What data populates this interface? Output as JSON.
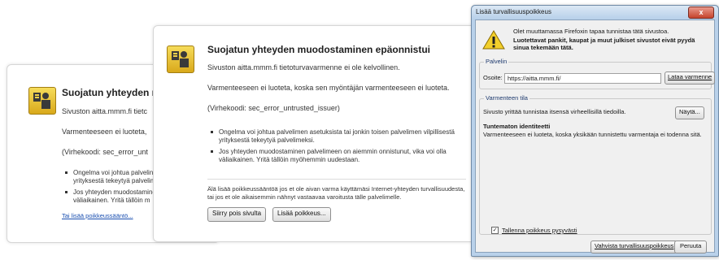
{
  "back": {
    "heading": "Suojatun yhteyden m",
    "line1": "Sivuston aitta.mmm.fi tietc",
    "line2": "Varmenteeseen ei luoteta,",
    "code": "(Virhekoodi: sec_error_unt",
    "bullets": [
      "Ongelma voi johtua palvelin",
      "yrityksestä tekeytyä palvelim",
      "Jos yhteyden muodostamine",
      "väliaikainen. Yritä tällöin m"
    ],
    "link": "Tai lisää poikkeussääntö..."
  },
  "mid": {
    "heading": "Suojatun yhteyden muodostaminen epäonnistui",
    "line1": "Sivuston aitta.mmm.fi tietoturvavarmenne ei ole kelvollinen.",
    "line2": "Varmenteeseen ei luoteta, koska sen myöntäjän varmenteeseen ei luoteta.",
    "code": "(Virhekoodi: sec_error_untrusted_issuer)",
    "bullets": [
      "Ongelma voi johtua palvelimen asetuksista tai jonkin toisen palvelimen vilpillisestä yrityksestä tekeytyä palvelimeksi.",
      "Jos yhteyden muodostaminen palvelimeen on aiemmin onnistunut, vika voi olla väliaikainen. Yritä tällöin myöhemmin uudestaan."
    ],
    "note": "Älä lisää poikkeussääntöä jos et ole aivan varma käyttämäsi Internet-yhteyden turvallisuudesta, tai jos et ole aikaisemmin nähnyt vastaavaa varoitusta tälle palvelimelle.",
    "btn_leave": "Siirry pois sivulta",
    "btn_add": "Lisää poikkeus..."
  },
  "dialog": {
    "title": "Lisää turvallisuuspoikkeus",
    "close": "x",
    "warn1": "Olet muuttamassa Firefoxin tapaa tunnistaa tätä sivustoa.",
    "warn2": "Luotettavat pankit, kaupat ja muut julkiset sivustot eivät pyydä sinua tekemään tätä.",
    "server_legend": "Palvelin",
    "address_label": "Osoite:",
    "address_value": "https://aitta.mmm.fi/",
    "btn_fetch": "Lataa varmenne",
    "cert_legend": "Varmenteen tila",
    "cert_status": "Sivusto yrittää tunnistaa itsensä virheellisillä tiedoilla.",
    "btn_show": "Näytä...",
    "unknown_heading": "Tuntematon identiteetti",
    "unknown_text": "Varmenteeseen ei luoteta, koska yksikään tunnistettu varmentaja ei todenna sitä.",
    "save_check": "✓",
    "save_label": "Tallenna poikkeus pysyvästi",
    "btn_confirm": "Vahvista turvallisuuspoikkeus",
    "btn_cancel": "Peruuta"
  }
}
